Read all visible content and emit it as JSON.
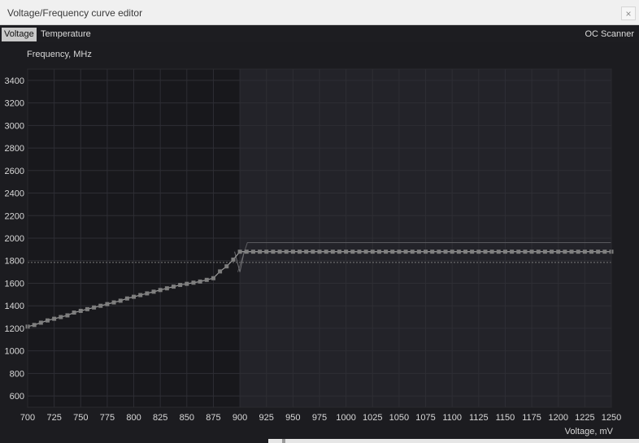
{
  "window": {
    "title": "Voltage/Frequency curve editor",
    "close_glyph": "×"
  },
  "tabs": [
    {
      "label": "Voltage"
    },
    {
      "label": "Temperature"
    }
  ],
  "oc_scanner": "OC Scanner",
  "axes": {
    "ylabel": "Frequency, MHz",
    "xlabel": "Voltage, mV"
  },
  "colors": {
    "background": "#1c1c20",
    "plot_left": "#18181c",
    "plot_right": "#232329",
    "curve": "#9a9a9a",
    "point": "#7e7e7e",
    "selected_line": "#ffffff"
  },
  "chart_data": {
    "type": "line",
    "xlabel": "Voltage, mV",
    "ylabel": "Frequency, MHz",
    "xlim": [
      700,
      1250
    ],
    "ylim": [
      500,
      3500
    ],
    "xticks": [
      700,
      725,
      750,
      775,
      800,
      825,
      850,
      875,
      900,
      925,
      950,
      975,
      1000,
      1025,
      1050,
      1075,
      1100,
      1125,
      1150,
      1175,
      1200,
      1225,
      1250
    ],
    "yticks": [
      600,
      800,
      1000,
      1200,
      1400,
      1600,
      1800,
      2000,
      2200,
      2400,
      2600,
      2800,
      3000,
      3200,
      3400
    ],
    "grid": true,
    "x_start": 700,
    "x_step": 6.25,
    "y": [
      1215,
      1230,
      1250,
      1270,
      1285,
      1300,
      1315,
      1340,
      1355,
      1370,
      1385,
      1400,
      1415,
      1430,
      1445,
      1465,
      1480,
      1495,
      1510,
      1525,
      1540,
      1555,
      1570,
      1585,
      1595,
      1605,
      1615,
      1630,
      1645,
      1705,
      1750,
      1810,
      1880,
      1880,
      1880,
      1880,
      1880,
      1880,
      1880,
      1880,
      1880,
      1880,
      1880,
      1880,
      1880,
      1880,
      1880,
      1880,
      1880,
      1880,
      1880,
      1880,
      1880,
      1880,
      1880,
      1880,
      1880,
      1880,
      1880,
      1880,
      1880,
      1880,
      1880,
      1880,
      1880,
      1880,
      1880,
      1880,
      1880,
      1880,
      1880,
      1880,
      1880,
      1880,
      1880,
      1880,
      1880,
      1880,
      1880,
      1880,
      1880,
      1880,
      1880,
      1880,
      1880,
      1880,
      1880,
      1880,
      1880
    ],
    "reference_line_y": 1785,
    "upper_line": [
      [
        898,
        1700
      ],
      [
        907,
        1960
      ],
      [
        1250,
        1960
      ]
    ],
    "dip_line": [
      [
        895,
        1880
      ],
      [
        900,
        1700
      ],
      [
        904,
        1880
      ]
    ],
    "selected_y": 1880,
    "locked_region_from_x": 900
  }
}
